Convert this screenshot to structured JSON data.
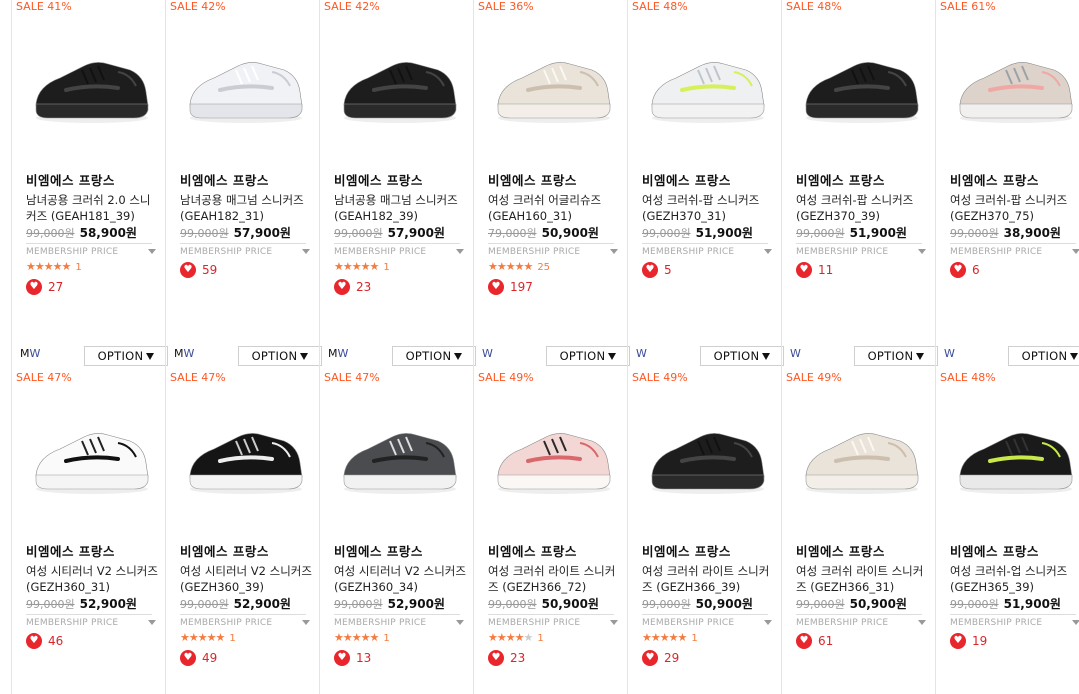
{
  "option_label": "OPTION",
  "membership_label": "MEMBERSHIP PRICE",
  "colors": {
    "sale": "#ff5722",
    "heart": "#e8262c",
    "star": "#f47b3f"
  },
  "rows": [
    [
      {
        "sale": "SALE 41%",
        "brand": "비엠에스 프랑스",
        "name": "남녀공용 크러쉬 2.0 스니커즈 (GEAH181_39)",
        "orig": "99,000원",
        "price": "58,900원",
        "rating": 5,
        "reviews": "1",
        "likes": "27",
        "gender_m": "M",
        "gender_w": "W",
        "shoe": "black",
        "icon": "black-sneaker-image"
      },
      {
        "sale": "SALE 42%",
        "brand": "비엠에스 프랑스",
        "name": "남녀공용 매그넘 스니커즈 (GEAH182_31)",
        "orig": "99,000원",
        "price": "57,900원",
        "rating": 0,
        "reviews": "",
        "likes": "59",
        "gender_m": "M",
        "gender_w": "W",
        "shoe": "white",
        "icon": "white-sneaker-image"
      },
      {
        "sale": "SALE 42%",
        "brand": "비엠에스 프랑스",
        "name": "남녀공용 매그넘 스니커즈 (GEAH182_39)",
        "orig": "99,000원",
        "price": "57,900원",
        "rating": 5,
        "reviews": "1",
        "likes": "23",
        "gender_m": "M",
        "gender_w": "W",
        "shoe": "black",
        "icon": "black-sneaker-image"
      },
      {
        "sale": "SALE 36%",
        "brand": "비엠에스 프랑스",
        "name": "여성 크러쉬 어글리슈즈 (GEAH160_31)",
        "orig": "79,000원",
        "price": "50,900원",
        "rating": 4.5,
        "reviews": "25",
        "likes": "197",
        "gender_m": "",
        "gender_w": "W",
        "shoe": "cream",
        "icon": "cream-sneaker-image"
      },
      {
        "sale": "SALE 48%",
        "brand": "비엠에스 프랑스",
        "name": "여성 크러쉬-팝 스니커즈 (GEZH370_31)",
        "orig": "99,000원",
        "price": "51,900원",
        "rating": 0,
        "reviews": "",
        "likes": "5",
        "gender_m": "",
        "gender_w": "W",
        "shoe": "lime",
        "icon": "white-lime-sneaker-image"
      },
      {
        "sale": "SALE 48%",
        "brand": "비엠에스 프랑스",
        "name": "여성 크러쉬-팝 스니커즈 (GEZH370_39)",
        "orig": "99,000원",
        "price": "51,900원",
        "rating": 0,
        "reviews": "",
        "likes": "11",
        "gender_m": "",
        "gender_w": "W",
        "shoe": "black",
        "icon": "black-sneaker-image"
      },
      {
        "sale": "SALE 61%",
        "brand": "비엠에스 프랑스",
        "name": "여성 크러쉬-팝 스니커즈 (GEZH370_75)",
        "orig": "99,000원",
        "price": "38,900원",
        "rating": 0,
        "reviews": "",
        "likes": "6",
        "gender_m": "",
        "gender_w": "W",
        "shoe": "pinkbeige",
        "icon": "beige-pink-sneaker-image"
      }
    ],
    [
      {
        "sale": "SALE 47%",
        "brand": "비엠에스 프랑스",
        "name": "여성 시티러너 V2 스니커즈 (GEZH360_31)",
        "orig": "99,000원",
        "price": "52,900원",
        "rating": 0,
        "reviews": "",
        "likes": "46",
        "shoe": "whitesock",
        "icon": "white-sock-sneaker-image"
      },
      {
        "sale": "SALE 47%",
        "brand": "비엠에스 프랑스",
        "name": "여성 시티러너 V2 스니커즈 (GEZH360_39)",
        "orig": "99,000원",
        "price": "52,900원",
        "rating": 5,
        "reviews": "1",
        "likes": "49",
        "shoe": "blacksock",
        "icon": "black-sock-sneaker-image"
      },
      {
        "sale": "SALE 47%",
        "brand": "비엠에스 프랑스",
        "name": "여성 시티러너 V2 스니커즈 (GEZH360_34)",
        "orig": "99,000원",
        "price": "52,900원",
        "rating": 5,
        "reviews": "1",
        "likes": "13",
        "shoe": "greysock",
        "icon": "grey-sock-sneaker-image"
      },
      {
        "sale": "SALE 49%",
        "brand": "비엠에스 프랑스",
        "name": "여성 크러쉬 라이트 스니커즈 (GEZH366_72)",
        "orig": "99,000원",
        "price": "50,900원",
        "rating": 4,
        "reviews": "1",
        "likes": "23",
        "shoe": "pink",
        "icon": "pink-sneaker-image"
      },
      {
        "sale": "SALE 49%",
        "brand": "비엠에스 프랑스",
        "name": "여성 크러쉬 라이트 스니커즈 (GEZH366_39)",
        "orig": "99,000원",
        "price": "50,900원",
        "rating": 5,
        "reviews": "1",
        "likes": "29",
        "shoe": "black",
        "icon": "black-sneaker-image"
      },
      {
        "sale": "SALE 49%",
        "brand": "비엠에스 프랑스",
        "name": "여성 크러쉬 라이트 스니커즈 (GEZH366_31)",
        "orig": "99,000원",
        "price": "50,900원",
        "rating": 0,
        "reviews": "",
        "likes": "61",
        "shoe": "cream",
        "icon": "beige-sneaker-image"
      },
      {
        "sale": "SALE 48%",
        "brand": "비엠에스 프랑스",
        "name": "여성 크러쉬-업 스니커즈 (GEZH365_39)",
        "orig": "99,000원",
        "price": "51,900원",
        "rating": 0,
        "reviews": "",
        "likes": "19",
        "shoe": "blacknet",
        "icon": "black-mesh-sneaker-image"
      }
    ]
  ]
}
